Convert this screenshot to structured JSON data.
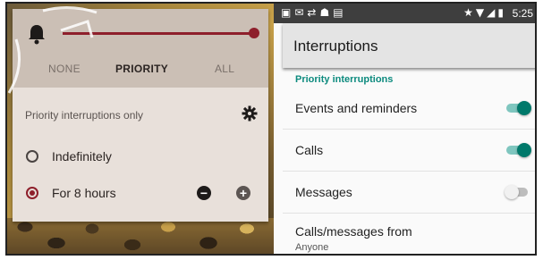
{
  "quick_settings": {
    "modes": [
      "NONE",
      "PRIORITY",
      "ALL"
    ],
    "active_mode": "PRIORITY",
    "priority_row_label": "Priority interruptions only",
    "options": [
      {
        "label": "Indefinitely",
        "selected": false
      },
      {
        "label": "For 8 hours",
        "selected": true
      }
    ],
    "accent_color": "#8e1f2b"
  },
  "status_bar": {
    "time": "5:25",
    "left_icons": [
      "image-icon",
      "mail-icon",
      "sync-icon",
      "android-icon",
      "clipboard-icon"
    ],
    "right_icons": [
      "star-icon",
      "wifi-icon",
      "signal-icon",
      "battery-icon"
    ]
  },
  "settings": {
    "title": "Interruptions",
    "section_header": "Priority interruptions",
    "accent_color": "#00796b",
    "rows": [
      {
        "label": "Events and reminders",
        "toggle": true
      },
      {
        "label": "Calls",
        "toggle": true
      },
      {
        "label": "Messages",
        "toggle": false
      },
      {
        "label": "Calls/messages from",
        "sublabel": "Anyone"
      }
    ]
  }
}
